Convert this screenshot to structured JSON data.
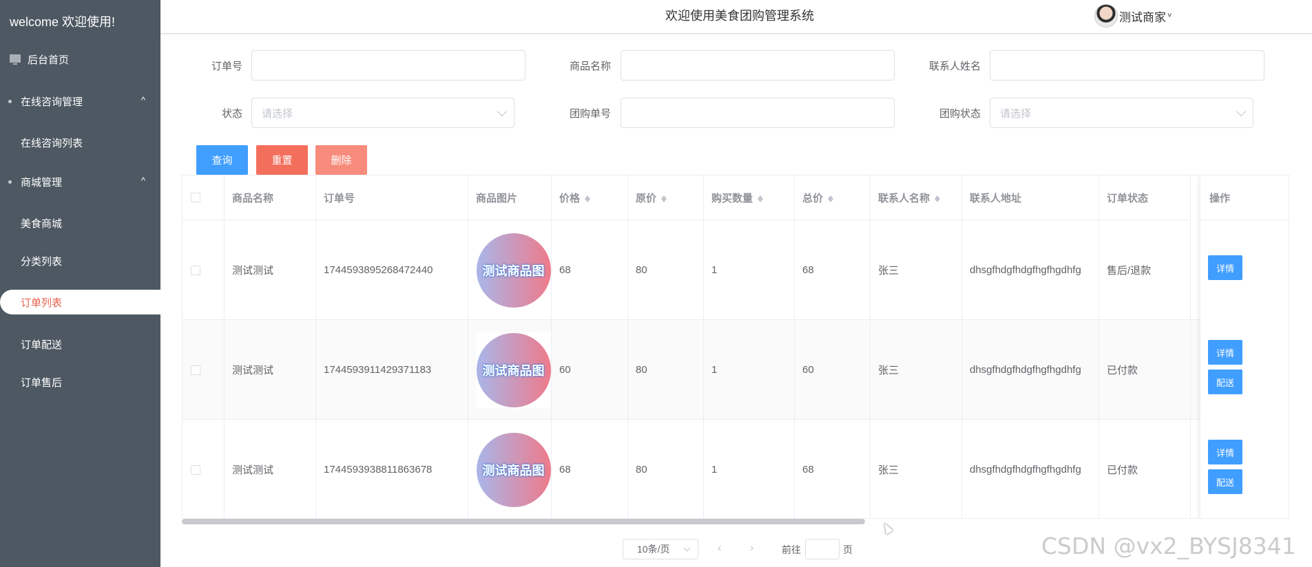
{
  "sidebar": {
    "welcome": "welcome 欢迎使用!",
    "items": [
      {
        "label": "后台首页"
      },
      {
        "label": "在线咨询管理",
        "arrow": "^"
      },
      {
        "label": "在线咨询列表"
      },
      {
        "label": "商城管理",
        "arrow": "^"
      },
      {
        "label": "美食商城"
      },
      {
        "label": "分类列表"
      },
      {
        "label": "订单列表"
      },
      {
        "label": "订单配送"
      },
      {
        "label": "订单售后"
      }
    ]
  },
  "header": {
    "title": "欢迎使用美食团购管理系统",
    "user": "测试商家",
    "caret": "˅"
  },
  "search": {
    "order_no_label": "订单号",
    "goods_name_label": "商品名称",
    "contact_name_label": "联系人姓名",
    "status_label": "状态",
    "status_placeholder": "请选择",
    "group_no_label": "团购单号",
    "group_status_label": "团购状态",
    "group_status_placeholder": "请选择",
    "order_no_value": "",
    "goods_name_value": "",
    "contact_name_value": "",
    "group_no_value": ""
  },
  "buttons": {
    "query": "查询",
    "reset": "重置",
    "delete": "删除",
    "colors": {
      "query": "#409eff",
      "reset": "#f46e5c",
      "delete": "#f78c7c"
    }
  },
  "table": {
    "headers": {
      "goods_name": "商品名称",
      "order_no": "订单号",
      "goods_img": "商品图片",
      "price": "价格",
      "orig_price": "原价",
      "qty": "购买数量",
      "total": "总价",
      "contact_name": "联系人名称",
      "contact_addr": "联系人地址",
      "order_status": "订单状态",
      "ops": "操作"
    },
    "image_text": "测试商品图",
    "rows": [
      {
        "goods_name": "测试测试",
        "order_no": "1744593895268472440",
        "price": "68",
        "orig_price": "80",
        "qty": "1",
        "total": "68",
        "contact_name": "张三",
        "contact_addr": "dhsgfhdgfhdgfhgfhgdhfg",
        "order_status": "售后/退款",
        "detail": "详情"
      },
      {
        "goods_name": "测试测试",
        "order_no": "1744593911429371183",
        "price": "60",
        "orig_price": "80",
        "qty": "1",
        "total": "60",
        "contact_name": "张三",
        "contact_addr": "dhsgfhdgfhdgfhgfhgdhfg",
        "order_status": "已付款",
        "detail": "详情",
        "ship": "配送"
      },
      {
        "goods_name": "测试测试",
        "order_no": "1744593938811863678",
        "price": "68",
        "orig_price": "80",
        "qty": "1",
        "total": "68",
        "contact_name": "张三",
        "contact_addr": "dhsgfhdgfhdgfhgfhgdhfg",
        "order_status": "已付款",
        "detail": "详情",
        "ship": "配送"
      }
    ]
  },
  "pagination": {
    "page_size": "10条/页",
    "prev": "‹",
    "next": "›",
    "goto_label": "前往",
    "page_unit": "页"
  },
  "watermark": "CSDN @vx2_BYSJ8341"
}
